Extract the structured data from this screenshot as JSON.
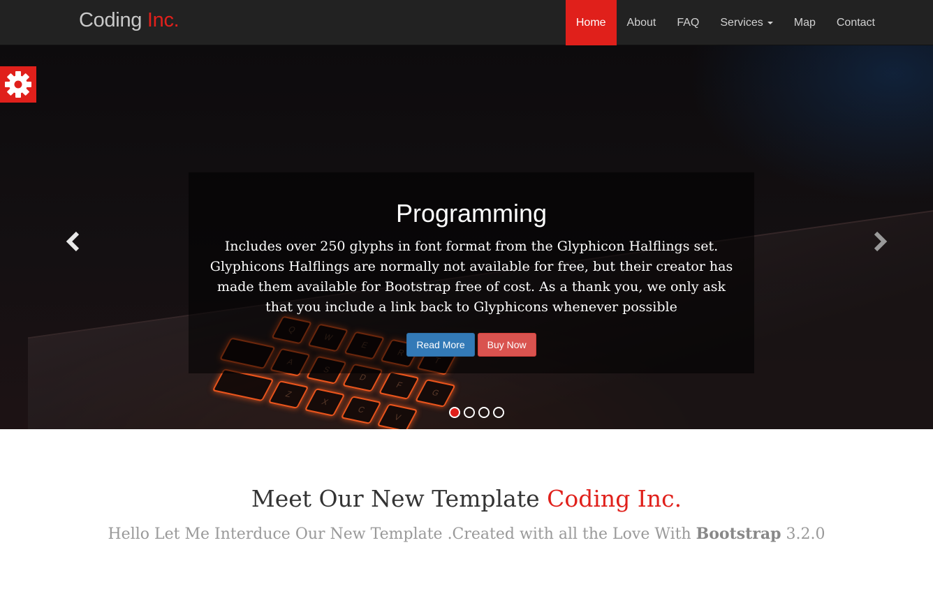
{
  "navbar": {
    "brand": "Coding",
    "brand_accent": "Inc.",
    "items": [
      {
        "label": "Home",
        "active": true
      },
      {
        "label": "About"
      },
      {
        "label": "FAQ"
      },
      {
        "label": "Services",
        "has_dropdown": true
      },
      {
        "label": "Map"
      },
      {
        "label": "Contact"
      }
    ]
  },
  "settings": {
    "icon": "gear-icon"
  },
  "carousel": {
    "title": "Programming",
    "text": "Includes over 250 glyphs in font format from the Glyphicon Halflings set. Glyphicons Halflings are normally not available for free, but their creator has made them available for Bootstrap free of cost. As a thank you, we only ask that you include a link back to Glyphicons whenever possible",
    "read_more": "Read More",
    "buy_now": "Buy Now",
    "slide_count": 4,
    "active_slide": 1,
    "prev_icon": "chevron-left-icon",
    "next_icon": "chevron-right-icon"
  },
  "intro": {
    "heading": "Meet Our New Template",
    "heading_accent": "Coding Inc.",
    "sub_before": "Hello Let Me Interduce Our New Template .Created with all the Love With",
    "sub_bold": "Bootstrap",
    "sub_after": "3.2.0"
  },
  "colors": {
    "accent": "#e0201b",
    "navbar_bg": "#222222",
    "primary_button": "#337ab7",
    "danger_button": "#d9534f"
  }
}
